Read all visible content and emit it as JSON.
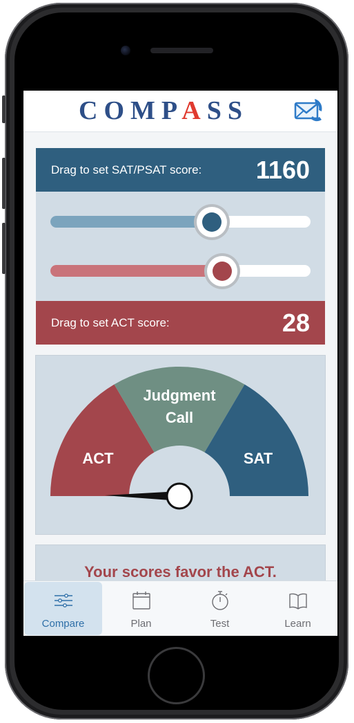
{
  "app": {
    "logo_text_before": "COMP",
    "logo_text_a": "A",
    "logo_text_after": "SS",
    "colors": {
      "brand_blue": "#2e4f88",
      "brand_red": "#e03a2f",
      "sat_blue": "#2f5f7f",
      "act_red": "#a3464c",
      "judgment_green": "#6f8f83",
      "panel_gray": "#d1dce5"
    }
  },
  "header": {
    "mail_icon": "envelope-phone-icon"
  },
  "sat": {
    "label": "Drag to set SAT/PSAT score:",
    "score": "1160",
    "slider_fraction": 0.62
  },
  "act": {
    "label": "Drag to set ACT score:",
    "score": "28",
    "slider_fraction": 0.66
  },
  "gauge": {
    "segments": {
      "act": "ACT",
      "judgment_line1": "Judgment",
      "judgment_line2": "Call",
      "sat": "SAT"
    },
    "needle_direction": "ACT"
  },
  "result": {
    "text": "Your scores favor the ACT."
  },
  "tabbar": {
    "tabs": [
      {
        "label": "Compare",
        "icon": "sliders-icon",
        "active": true
      },
      {
        "label": "Plan",
        "icon": "calendar-icon",
        "active": false
      },
      {
        "label": "Test",
        "icon": "stopwatch-icon",
        "active": false
      },
      {
        "label": "Learn",
        "icon": "book-icon",
        "active": false
      }
    ]
  }
}
